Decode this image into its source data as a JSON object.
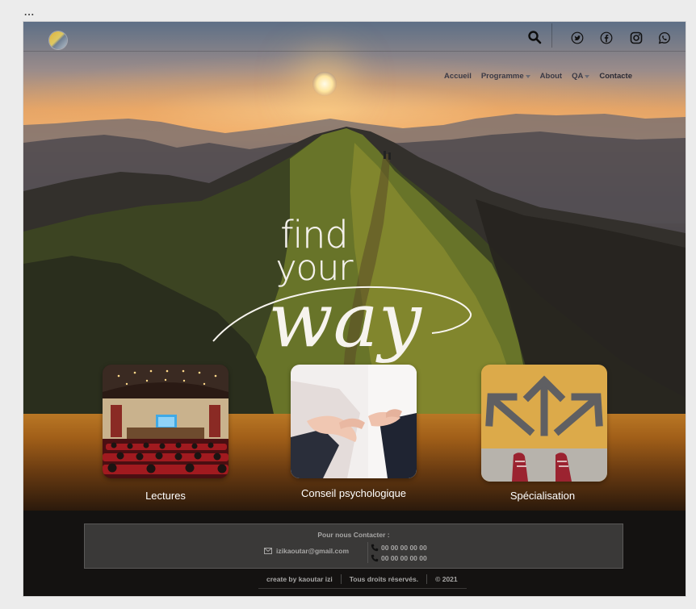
{
  "window": {
    "menu_dots": "..."
  },
  "header": {
    "logo_icon": "sun-mountain-logo-icon",
    "search_icon": "search-icon",
    "social_icons": [
      "twitter-icon",
      "facebook-icon",
      "instagram-icon",
      "whatsapp-icon"
    ]
  },
  "nav": {
    "items": [
      {
        "label": "Accueil",
        "has_dropdown": false
      },
      {
        "label": "Programme",
        "has_dropdown": true
      },
      {
        "label": "About",
        "has_dropdown": false
      },
      {
        "label": "QA",
        "has_dropdown": true
      },
      {
        "label": "Contacte",
        "has_dropdown": false
      }
    ]
  },
  "hero": {
    "tagline": {
      "line1": "find",
      "line2": "your",
      "line3": "way"
    }
  },
  "cards": [
    {
      "label": "Lectures",
      "image": "lecture-hall-image"
    },
    {
      "label": "Conseil psychologique",
      "image": "counseling-hands-image"
    },
    {
      "label": "Spécialisation",
      "image": "direction-arrows-image"
    }
  ],
  "footer": {
    "contact_title": "Pour nous Contacter :",
    "email": "izikaoutar@gmail.com",
    "phones": [
      "00 00 00 00 00",
      "00 00 00 00 00"
    ],
    "credits": {
      "author": "create by kaoutar izi",
      "rights": "Tous droits réservés.",
      "year": "© 2021"
    }
  },
  "colors": {
    "nav_text": "#3a3a46",
    "footer_bg": "#141211",
    "contact_box_bg": "#3a3938",
    "footer_text": "#a7a6a5"
  }
}
